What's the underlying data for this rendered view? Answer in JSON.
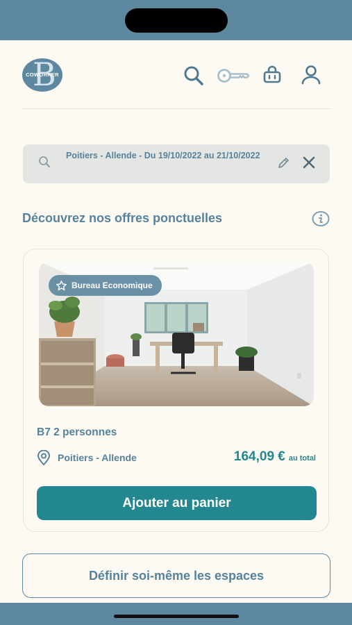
{
  "header": {
    "logo_text": "COWORKER",
    "logo_letter": "B",
    "icons": [
      "search-icon",
      "key-icon",
      "basket-icon",
      "user-icon"
    ]
  },
  "search": {
    "summary": "Poitiers - Allende - Du 19/10/2022  au 21/10/2022"
  },
  "section": {
    "title": "Découvrez nos offres ponctuelles"
  },
  "offer": {
    "badge": "Bureau Economique",
    "name": "B7 2 personnes",
    "location": "Poitiers - Allende",
    "price": "164,09 €",
    "price_suffix": "au total",
    "add_button": "Ajouter au panier"
  },
  "footer": {
    "define_button": "Définir soi-même les espaces"
  },
  "colors": {
    "brand_blue": "#5d889f",
    "teal": "#22878e",
    "background": "#fdf9f3"
  }
}
